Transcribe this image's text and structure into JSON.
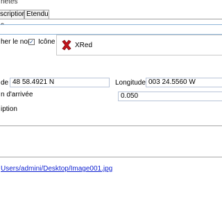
{
  "window": {
    "title": "riétés"
  },
  "tabs": [
    {
      "label": "scription"
    },
    {
      "label": "Etendu"
    }
  ],
  "form": {
    "name_section_label": "s",
    "name_value": "",
    "show_name_label": "her le nom",
    "show_name_checked": "✓",
    "icon_label": "Icône",
    "icon": {
      "name": "XRed",
      "symbol": "x-red-icon",
      "color": "#c4141b"
    },
    "latitude_label": "de",
    "latitude_value": "48 58.4921 N",
    "longitude_label": "Longitude",
    "longitude_value": "003 24.5560 W",
    "arrival_label": "n d'arrivée",
    "arrival_value": "0.050",
    "description_label": "iption",
    "description_value": "",
    "file_link": "Users/admini/Desktop/Image001.jpg"
  }
}
